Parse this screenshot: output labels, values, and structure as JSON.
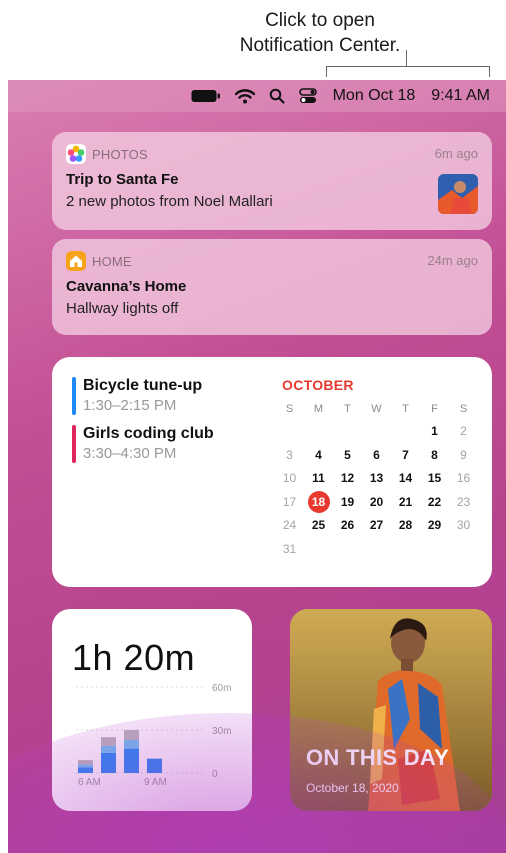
{
  "callout": {
    "line1": "Click to open",
    "line2": "Notification Center."
  },
  "menubar": {
    "icons": [
      "battery-icon",
      "wifi-icon",
      "search-icon",
      "control-center-icon"
    ],
    "date": "Mon Oct 18",
    "time": "9:41 AM"
  },
  "notifications": [
    {
      "app": "PHOTOS",
      "time": "6m ago",
      "title": "Trip to Santa Fe",
      "body": "2 new photos from Noel Mallari"
    },
    {
      "app": "HOME",
      "time": "24m ago",
      "title": "Cavanna’s Home",
      "body": "Hallway lights off"
    }
  ],
  "calendar": {
    "events": [
      {
        "name": "Bicycle tune-up",
        "time": "1:30–2:15 PM",
        "color": "#1f8af5"
      },
      {
        "name": "Girls coding club",
        "time": "3:30–4:30 PM",
        "color": "#e0245e"
      }
    ],
    "month": "OCTOBER",
    "weekdays": [
      "S",
      "M",
      "T",
      "W",
      "T",
      "F",
      "S"
    ],
    "weeks": [
      [
        "",
        "",
        "",
        "",
        "",
        "1",
        "2"
      ],
      [
        "3",
        "4",
        "5",
        "6",
        "7",
        "8",
        "9"
      ],
      [
        "10",
        "11",
        "12",
        "13",
        "14",
        "15",
        "16"
      ],
      [
        "17",
        "18",
        "19",
        "20",
        "21",
        "22",
        "23"
      ],
      [
        "24",
        "25",
        "26",
        "27",
        "28",
        "29",
        "30"
      ],
      [
        "31",
        "",
        "",
        "",
        "",
        "",
        ""
      ]
    ],
    "today": "18",
    "accent": "#e8392f"
  },
  "screentime": {
    "total": "1h 20m",
    "y_labels": [
      "60m",
      "30m",
      "0"
    ],
    "x_labels": [
      "6 AM",
      "9 AM"
    ],
    "bars": [
      {
        "blue": 4,
        "cyan": 2,
        "gray": 3
      },
      {
        "blue": 14,
        "cyan": 5,
        "gray": 6
      },
      {
        "blue": 17,
        "cyan": 6,
        "gray": 7
      },
      {
        "blue": 10,
        "cyan": 0,
        "gray": 0
      }
    ]
  },
  "on_this_day": {
    "title": "ON THIS DAY",
    "date": "October 18, 2020"
  }
}
